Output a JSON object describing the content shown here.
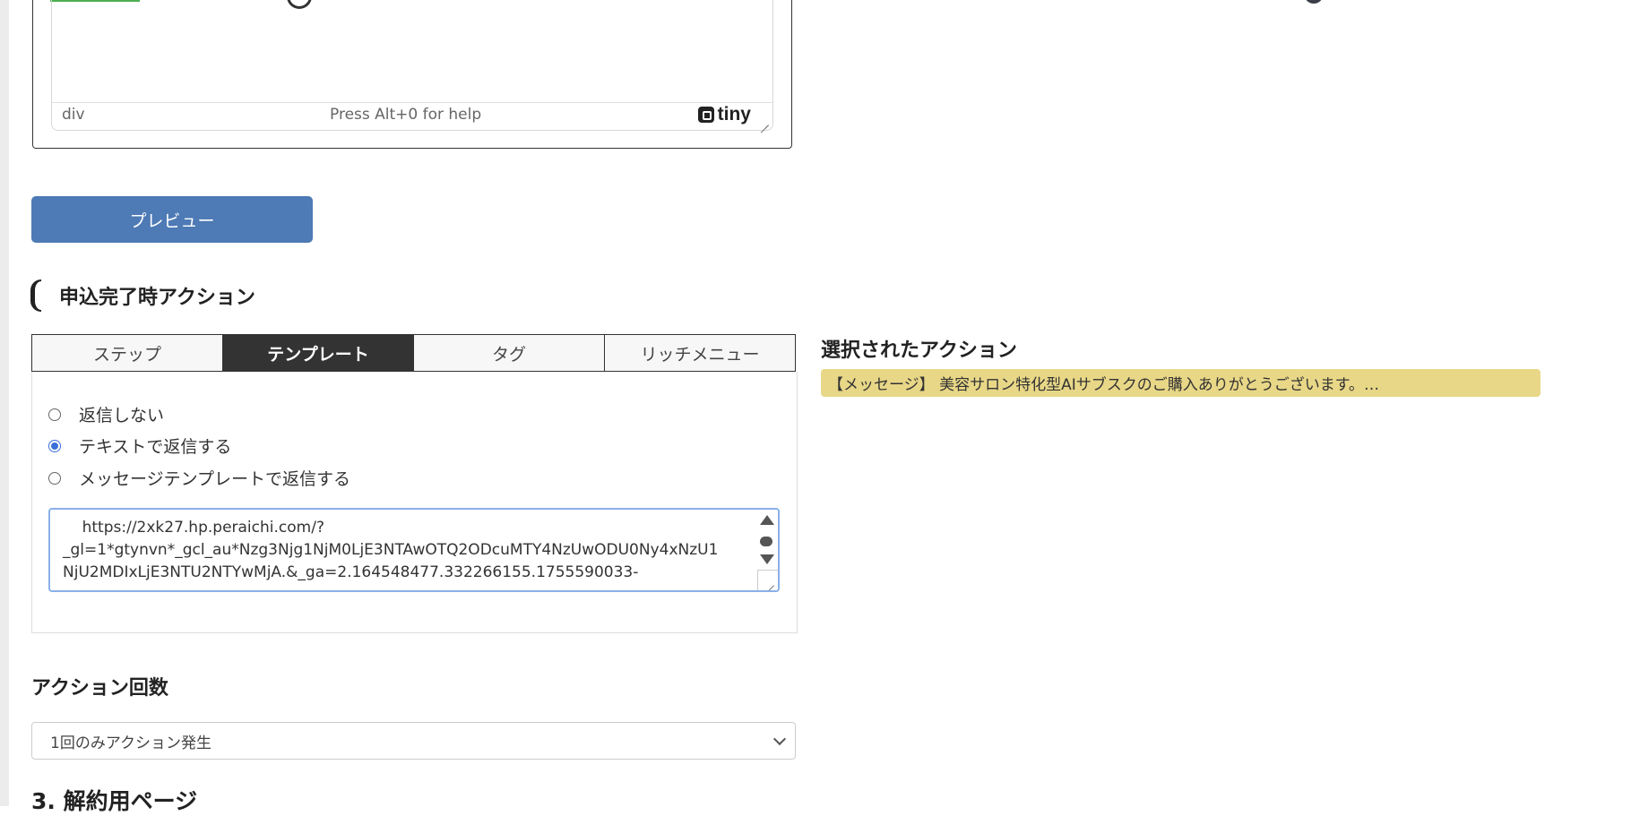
{
  "editor": {
    "path": "div",
    "help": "Press Alt+0 for help",
    "brand": "tiny"
  },
  "preview_label": "プレビュー",
  "section": {
    "title": "申込完了時アクション"
  },
  "tabs": [
    {
      "label": "ステップ",
      "active": false
    },
    {
      "label": "テンプレート",
      "active": true
    },
    {
      "label": "タグ",
      "active": false
    },
    {
      "label": "リッチメニュー",
      "active": false
    }
  ],
  "reply_options": [
    {
      "label": "返信しない",
      "checked": false
    },
    {
      "label": "テキストで返信する",
      "checked": true
    },
    {
      "label": "メッセージテンプレートで返信する",
      "checked": false
    }
  ],
  "reply_text": "    https://2xk27.hp.peraichi.com/?\n_gl=1*gtynvn*_gcl_au*Nzg3Njg1NjM0LjE3NTAwOTQ2ODcuMTY4NzUwODU0Ny4xNzU1\nNjU2MDIxLjE3NTU2NTYwMjA.&_ga=2.164548477.332266155.1755590033-",
  "selected_action": {
    "title": "選択されたアクション",
    "badge": "【メッセージ】 美容サロン特化型AIサブスクのご購入ありがとうございます。…",
    "badge_color": "#e8d787"
  },
  "action_count": {
    "label": "アクション回数",
    "selected": "1回のみアクション発生"
  },
  "next_section_title": "3. 解約用ページ",
  "colors": {
    "primary_button": "#4e7ab5",
    "active_tab": "#333333",
    "radio_checked": "#3a6fd8"
  }
}
